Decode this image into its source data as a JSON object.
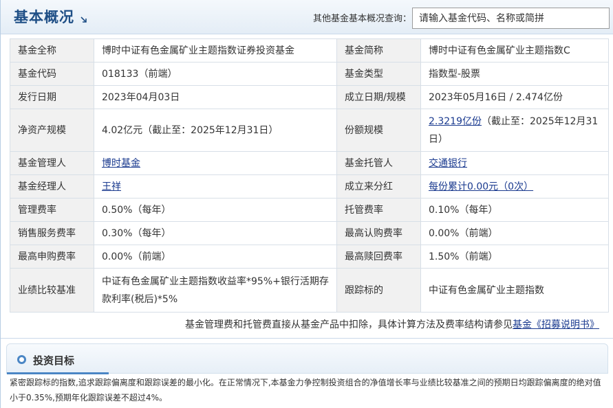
{
  "header": {
    "title": "基本概况",
    "search_label": "其他基金基本概况查询：",
    "search_placeholder": "请输入基金代码、名称或简拼"
  },
  "rows": {
    "full_name": {
      "label": "基金全称",
      "value": "博时中证有色金属矿业主题指数证券投资基金"
    },
    "short_name": {
      "label": "基金简称",
      "value": "博时中证有色金属矿业主题指数C"
    },
    "code": {
      "label": "基金代码",
      "value": "018133（前端）"
    },
    "type": {
      "label": "基金类型",
      "value": "指数型-股票"
    },
    "issue_date": {
      "label": "发行日期",
      "value": "2023年04月03日"
    },
    "establish": {
      "label": "成立日期/规模",
      "value": "2023年05月16日 / 2.474亿份"
    },
    "net_assets": {
      "label": "净资产规模",
      "value": "4.02亿元（截止至：2025年12月31日）"
    },
    "shares": {
      "label": "份额规模",
      "link": "2.3219亿份",
      "value": "（截止至：2025年12月31日）"
    },
    "manager_co": {
      "label": "基金管理人",
      "link": "博时基金"
    },
    "custodian": {
      "label": "基金托管人",
      "link": "交通银行"
    },
    "manager": {
      "label": "基金经理人",
      "link": "王祥"
    },
    "dividend": {
      "label": "成立来分红",
      "link": "每份累计0.00元（0次）"
    },
    "mgmt_fee": {
      "label": "管理费率",
      "value": "0.50%（每年）"
    },
    "custody_fee": {
      "label": "托管费率",
      "value": "0.10%（每年）"
    },
    "sales_fee": {
      "label": "销售服务费率",
      "value": "0.30%（每年）"
    },
    "subscribe_fee": {
      "label": "最高认购费率",
      "value": "0.00%（前端）"
    },
    "purchase_fee": {
      "label": "最高申购费率",
      "value": "0.00%（前端）"
    },
    "redeem_fee": {
      "label": "最高赎回费率",
      "value": "1.50%（前端）"
    },
    "benchmark": {
      "label": "业绩比较基准",
      "value": "中证有色金属矿业主题指数收益率*95%+银行活期存款利率(税后)*5%"
    },
    "tracking": {
      "label": "跟踪标的",
      "value": "中证有色金属矿业主题指数"
    }
  },
  "note": {
    "text": "基金管理费和托管费直接从基金产品中扣除，具体计算方法及费率结构请参见",
    "link": "基金《招募说明书》"
  },
  "objective": {
    "title": "投资目标",
    "text": "紧密跟踪标的指数,追求跟踪偏离度和跟踪误差的最小化。在正常情况下,本基金力争控制投资组合的净值增长率与业绩比较基准之间的预期日均跟踪偏离度的绝对值小于0.35%,预期年化跟踪误差不超过4%。"
  }
}
